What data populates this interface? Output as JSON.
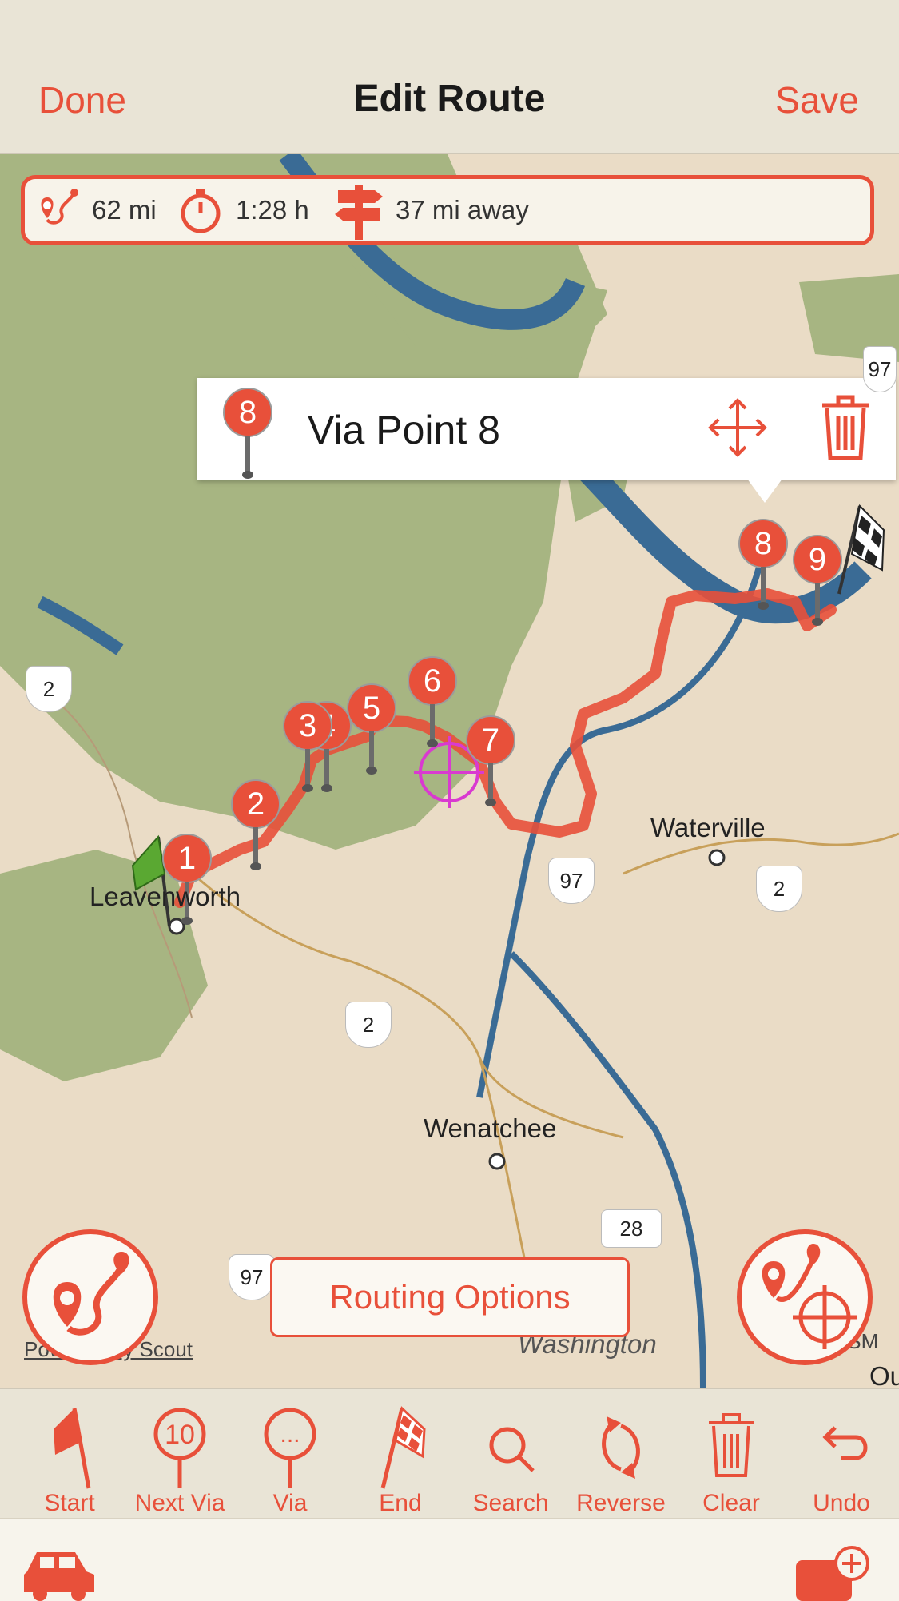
{
  "nav": {
    "done_label": "Done",
    "title": "Edit Route",
    "save_label": "Save"
  },
  "stats": {
    "distance": "62 mi",
    "duration": "1:28 h",
    "away": "37 mi away"
  },
  "callout": {
    "pin_number": "8",
    "label": "Via Point 8"
  },
  "route_pins": [
    "1",
    "2",
    "3",
    "4",
    "5",
    "6",
    "7",
    "8",
    "9"
  ],
  "map_labels": {
    "leavenworth": "Leavenworth",
    "waterville": "Waterville",
    "wenatchee": "Wenatchee",
    "washington": "Washington",
    "credit": "Powered by Scout",
    "osm": "OSM",
    "edge": "Ou"
  },
  "shields": {
    "us2_a": "2",
    "us2_b": "2",
    "us2_c": "2",
    "us97_a": "97",
    "us97_b": "97",
    "us97_c": "97",
    "wa28": "28"
  },
  "routing_options_label": "Routing Options",
  "toolbar": {
    "start": "Start",
    "next_via": "Next Via",
    "next_via_number": "10",
    "via": "Via",
    "via_dots": "...",
    "end": "End",
    "search": "Search",
    "reverse": "Reverse",
    "clear": "Clear",
    "undo": "Undo"
  },
  "colors": {
    "accent": "#e8503a",
    "forest": "#a7b582",
    "water": "#3a6b95",
    "land": "#eadcc6"
  }
}
